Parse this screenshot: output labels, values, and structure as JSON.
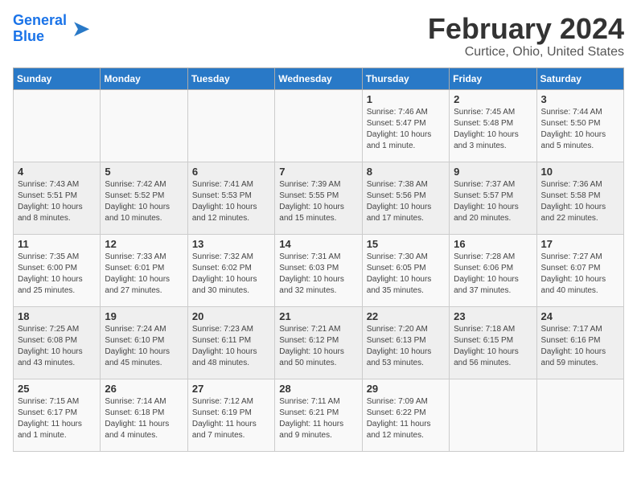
{
  "header": {
    "logo_line1": "General",
    "logo_line2": "Blue",
    "month_title": "February 2024",
    "location": "Curtice, Ohio, United States"
  },
  "days_of_week": [
    "Sunday",
    "Monday",
    "Tuesday",
    "Wednesday",
    "Thursday",
    "Friday",
    "Saturday"
  ],
  "weeks": [
    [
      {
        "num": "",
        "detail": ""
      },
      {
        "num": "",
        "detail": ""
      },
      {
        "num": "",
        "detail": ""
      },
      {
        "num": "",
        "detail": ""
      },
      {
        "num": "1",
        "detail": "Sunrise: 7:46 AM\nSunset: 5:47 PM\nDaylight: 10 hours\nand 1 minute."
      },
      {
        "num": "2",
        "detail": "Sunrise: 7:45 AM\nSunset: 5:48 PM\nDaylight: 10 hours\nand 3 minutes."
      },
      {
        "num": "3",
        "detail": "Sunrise: 7:44 AM\nSunset: 5:50 PM\nDaylight: 10 hours\nand 5 minutes."
      }
    ],
    [
      {
        "num": "4",
        "detail": "Sunrise: 7:43 AM\nSunset: 5:51 PM\nDaylight: 10 hours\nand 8 minutes."
      },
      {
        "num": "5",
        "detail": "Sunrise: 7:42 AM\nSunset: 5:52 PM\nDaylight: 10 hours\nand 10 minutes."
      },
      {
        "num": "6",
        "detail": "Sunrise: 7:41 AM\nSunset: 5:53 PM\nDaylight: 10 hours\nand 12 minutes."
      },
      {
        "num": "7",
        "detail": "Sunrise: 7:39 AM\nSunset: 5:55 PM\nDaylight: 10 hours\nand 15 minutes."
      },
      {
        "num": "8",
        "detail": "Sunrise: 7:38 AM\nSunset: 5:56 PM\nDaylight: 10 hours\nand 17 minutes."
      },
      {
        "num": "9",
        "detail": "Sunrise: 7:37 AM\nSunset: 5:57 PM\nDaylight: 10 hours\nand 20 minutes."
      },
      {
        "num": "10",
        "detail": "Sunrise: 7:36 AM\nSunset: 5:58 PM\nDaylight: 10 hours\nand 22 minutes."
      }
    ],
    [
      {
        "num": "11",
        "detail": "Sunrise: 7:35 AM\nSunset: 6:00 PM\nDaylight: 10 hours\nand 25 minutes."
      },
      {
        "num": "12",
        "detail": "Sunrise: 7:33 AM\nSunset: 6:01 PM\nDaylight: 10 hours\nand 27 minutes."
      },
      {
        "num": "13",
        "detail": "Sunrise: 7:32 AM\nSunset: 6:02 PM\nDaylight: 10 hours\nand 30 minutes."
      },
      {
        "num": "14",
        "detail": "Sunrise: 7:31 AM\nSunset: 6:03 PM\nDaylight: 10 hours\nand 32 minutes."
      },
      {
        "num": "15",
        "detail": "Sunrise: 7:30 AM\nSunset: 6:05 PM\nDaylight: 10 hours\nand 35 minutes."
      },
      {
        "num": "16",
        "detail": "Sunrise: 7:28 AM\nSunset: 6:06 PM\nDaylight: 10 hours\nand 37 minutes."
      },
      {
        "num": "17",
        "detail": "Sunrise: 7:27 AM\nSunset: 6:07 PM\nDaylight: 10 hours\nand 40 minutes."
      }
    ],
    [
      {
        "num": "18",
        "detail": "Sunrise: 7:25 AM\nSunset: 6:08 PM\nDaylight: 10 hours\nand 43 minutes."
      },
      {
        "num": "19",
        "detail": "Sunrise: 7:24 AM\nSunset: 6:10 PM\nDaylight: 10 hours\nand 45 minutes."
      },
      {
        "num": "20",
        "detail": "Sunrise: 7:23 AM\nSunset: 6:11 PM\nDaylight: 10 hours\nand 48 minutes."
      },
      {
        "num": "21",
        "detail": "Sunrise: 7:21 AM\nSunset: 6:12 PM\nDaylight: 10 hours\nand 50 minutes."
      },
      {
        "num": "22",
        "detail": "Sunrise: 7:20 AM\nSunset: 6:13 PM\nDaylight: 10 hours\nand 53 minutes."
      },
      {
        "num": "23",
        "detail": "Sunrise: 7:18 AM\nSunset: 6:15 PM\nDaylight: 10 hours\nand 56 minutes."
      },
      {
        "num": "24",
        "detail": "Sunrise: 7:17 AM\nSunset: 6:16 PM\nDaylight: 10 hours\nand 59 minutes."
      }
    ],
    [
      {
        "num": "25",
        "detail": "Sunrise: 7:15 AM\nSunset: 6:17 PM\nDaylight: 11 hours\nand 1 minute."
      },
      {
        "num": "26",
        "detail": "Sunrise: 7:14 AM\nSunset: 6:18 PM\nDaylight: 11 hours\nand 4 minutes."
      },
      {
        "num": "27",
        "detail": "Sunrise: 7:12 AM\nSunset: 6:19 PM\nDaylight: 11 hours\nand 7 minutes."
      },
      {
        "num": "28",
        "detail": "Sunrise: 7:11 AM\nSunset: 6:21 PM\nDaylight: 11 hours\nand 9 minutes."
      },
      {
        "num": "29",
        "detail": "Sunrise: 7:09 AM\nSunset: 6:22 PM\nDaylight: 11 hours\nand 12 minutes."
      },
      {
        "num": "",
        "detail": ""
      },
      {
        "num": "",
        "detail": ""
      }
    ]
  ]
}
